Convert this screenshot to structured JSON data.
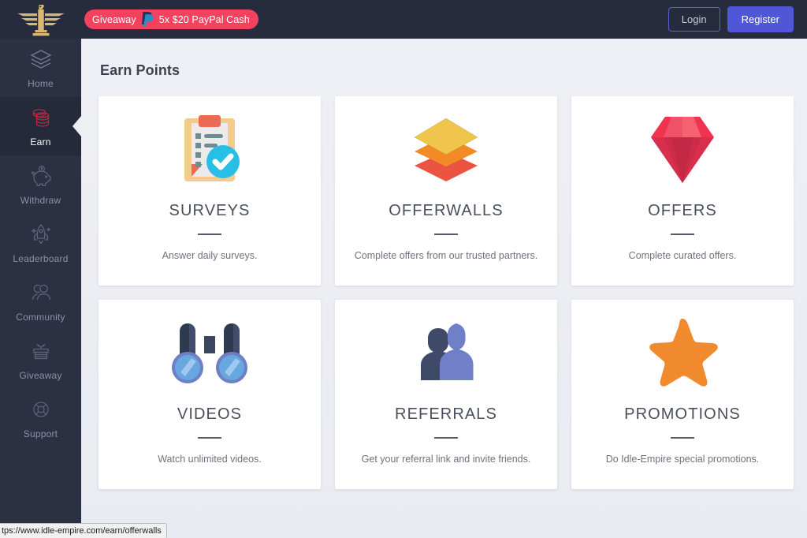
{
  "header": {
    "logo_icon": "eagle-emblem-logo",
    "giveaway": {
      "label": "Giveaway",
      "payment_icon": "paypal-icon",
      "prize": "5x $20 PayPal Cash"
    },
    "login_label": "Login",
    "register_label": "Register",
    "colors": {
      "background": "#262b3d",
      "badge": "#f4415f",
      "register": "#4f56d8",
      "login_border": "#5a5fd6",
      "logo_gold": "#d6b774"
    }
  },
  "sidebar": {
    "background": "#2b3043",
    "active_background": "#252a3b",
    "active_icon_color": "#c0243f",
    "items": [
      {
        "label": "Home",
        "icon": "layers-icon",
        "active": false
      },
      {
        "label": "Earn",
        "icon": "coins-icon",
        "active": true
      },
      {
        "label": "Withdraw",
        "icon": "piggy-bank-icon",
        "active": false
      },
      {
        "label": "Leaderboard",
        "icon": "rocket-icon",
        "active": false
      },
      {
        "label": "Community",
        "icon": "people-icon",
        "active": false
      },
      {
        "label": "Giveaway",
        "icon": "gift-box-icon",
        "active": false
      },
      {
        "label": "Support",
        "icon": "life-ring-icon",
        "active": false
      }
    ]
  },
  "main": {
    "page_title": "Earn Points",
    "cards": [
      {
        "title": "SURVEYS",
        "description": "Answer daily surveys.",
        "icon": "clipboard-check-icon"
      },
      {
        "title": "OFFERWALLS",
        "description": "Complete offers from our trusted partners.",
        "icon": "stacked-layers-icon"
      },
      {
        "title": "OFFERS",
        "description": "Complete curated offers.",
        "icon": "diamond-icon"
      },
      {
        "title": "VIDEOS",
        "description": "Watch unlimited videos.",
        "icon": "binoculars-icon"
      },
      {
        "title": "REFERRALS",
        "description": "Get your referral link and invite friends.",
        "icon": "two-people-icon"
      },
      {
        "title": "PROMOTIONS",
        "description": "Do Idle-Empire special promotions.",
        "icon": "star-icon"
      }
    ]
  },
  "status_bar": {
    "url": "tps://www.idle-empire.com/earn/offerwalls"
  }
}
